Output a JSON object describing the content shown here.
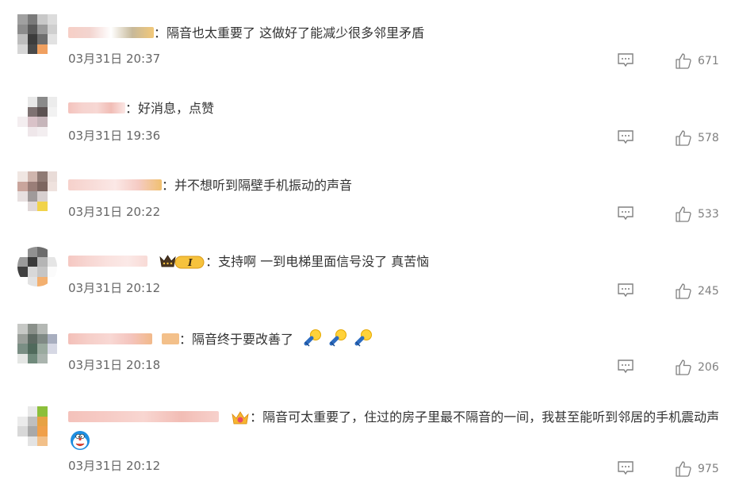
{
  "comments": [
    {
      "text": "隔音也太重要了 这做好了能减少很多邻里矛盾",
      "date": "03月31日 20:37",
      "likes": "671",
      "avatar": [
        "#a0a0a0",
        "#7a7a7a",
        "#c8c8c8",
        "#dcdcdc",
        "#8c8c8c",
        "#5a5a5a",
        "#9a9a9a",
        "#cfcfcf",
        "#bdbdbd",
        "#3c3c3c",
        "#6e6e6e",
        "#e2e2e2",
        "#d6d6d6",
        "#4a4a4a",
        "#f0a060",
        "#ffffff"
      ],
      "name_colors": [
        "#f6cfc6",
        "#f3d4cf",
        "#ffffff",
        "#c7b99a",
        "#f2c879"
      ]
    },
    {
      "text": "好消息，点赞",
      "date": "03月31日 19:36",
      "likes": "578",
      "avatar": [
        "#ffffff",
        "#e8e8e8",
        "#8a8a8a",
        "#ececec",
        "#ffffff",
        "#7e7272",
        "#5c5252",
        "#f2f2f2",
        "#f4eef0",
        "#d9c2c8",
        "#c6b5ba",
        "#ffffff",
        "#ffffff",
        "#efe7ea",
        "#f3eef0",
        "#ffffff"
      ],
      "name_colors": [
        "#f4c3bd",
        "#f6d3cf",
        "#f7d8d4",
        "#f1bdb6",
        "#fbe7e5"
      ]
    },
    {
      "text": "并不想听到隔壁手机振动的声音",
      "date": "03月31日 20:22",
      "likes": "533",
      "avatar": [
        "#f0e6e2",
        "#cfb5ad",
        "#8f7a74",
        "#e9dcd8",
        "#c9a59c",
        "#9a7e78",
        "#7d6660",
        "#efe2de",
        "#e7e0e0",
        "#a09a9a",
        "#d7cfcf",
        "#ffffff",
        "#ffffff",
        "#e0d8d8",
        "#f1d34a",
        "#ffffff"
      ],
      "name_colors": [
        "#f6d1cb",
        "#f8dcd8",
        "#fbe8e6",
        "#f5cbc4",
        "#f0c070"
      ]
    },
    {
      "text": "支持啊 一到电梯里面信号没了 真苦恼",
      "date": "03月31日 20:12",
      "likes": "245",
      "badge": "I",
      "avatar": [
        "#ffffff",
        "#909090",
        "#6c6c6c",
        "#ffffff",
        "#9a9a9a",
        "#3a3a3a",
        "#b5b5b5",
        "#e5e5e5",
        "#404040",
        "#d8d8d8",
        "#c5c5c5",
        "#fbfbfb",
        "#ffffff",
        "#e2e2e2",
        "#f3b070",
        "#ffffff"
      ],
      "name_colors": [
        "#f5c8c2",
        "#f7d6d2",
        "#fae2df",
        "#fbe9e7",
        "#f8dad6"
      ]
    },
    {
      "text": "隔音终于要改善了",
      "date": "03月31日 20:18",
      "likes": "206",
      "avatar": [
        "#c6c8c5",
        "#8a908a",
        "#b4b8b4",
        "#ffffff",
        "#9a9f9a",
        "#5e6a63",
        "#808a85",
        "#a8aebf",
        "#7a8e84",
        "#506a5c",
        "#9aaa9f",
        "#d6d8e4",
        "#e4e6e4",
        "#708a7c",
        "#aab4ae",
        "#ffffff"
      ],
      "name_colors": [
        "#f3c0b9",
        "#f6cfc9",
        "#f8d8d4",
        "#f4c4bd",
        "#f2b98a"
      ]
    },
    {
      "text": "隔音可太重要了，住过的房子里最不隔音的一间，我甚至能听到邻居的手机震动声",
      "date": "03月31日 20:12",
      "likes": "975",
      "avatar": [
        "#ffffff",
        "#e9e9e9",
        "#8cbf3a",
        "#ffffff",
        "#ebebeb",
        "#bfbfbf",
        "#e7a244",
        "#ffffff",
        "#d8d8d8",
        "#a9a9a9",
        "#f0a04a",
        "#ffffff",
        "#ffffff",
        "#e3e3e3",
        "#f2c089",
        "#ffffff"
      ],
      "name_colors": [
        "#f4c2bb",
        "#f6cbc5",
        "#f8d6d1",
        "#f2bdb5",
        "#f7d1cc"
      ]
    }
  ],
  "icons": {
    "reply": "comment-icon",
    "like": "thumbs-up-icon",
    "crown": "crown-badge-icon",
    "lightbulb": "lightbulb-emoji-icon",
    "doraemon": "doraemon-emoji-icon"
  },
  "colors": {
    "text": "#333333",
    "meta": "#666666",
    "icon": "#808080"
  }
}
